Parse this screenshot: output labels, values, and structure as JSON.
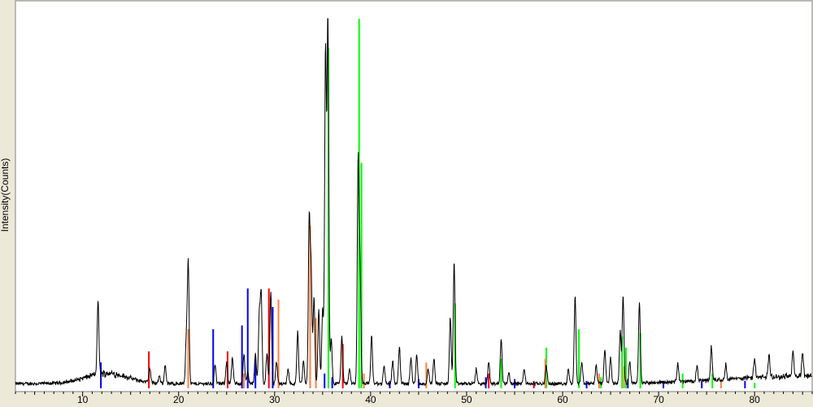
{
  "chart_data": {
    "type": "line",
    "title": "",
    "xlabel": "",
    "ylabel": "Intensity(Counts)",
    "xlim": [
      3,
      86
    ],
    "ylim": [
      0,
      1000
    ],
    "xticks": [
      10,
      20,
      30,
      40,
      50,
      60,
      70,
      80
    ],
    "grid": false,
    "colors": {
      "background": "#ffffff",
      "frame": "#ece9d8",
      "pattern": "#000000",
      "blue": "#0000ff",
      "red": "#ff0000",
      "orange": "#ff8040",
      "green": "#00ff00"
    },
    "pattern": {
      "name": "",
      "color": "#000000",
      "baseline": 8,
      "noise": 9,
      "humps": [
        {
          "center": 12.5,
          "width": 2.2,
          "height": 35
        },
        {
          "center": 85,
          "width": 8,
          "height": 25
        }
      ],
      "peaks": [
        [
          11.6,
          200
        ],
        [
          17.0,
          40
        ],
        [
          18.0,
          20
        ],
        [
          18.6,
          50
        ],
        [
          20.8,
          120
        ],
        [
          21.0,
          330
        ],
        [
          23.8,
          50
        ],
        [
          25.0,
          60
        ],
        [
          25.6,
          70
        ],
        [
          26.8,
          80
        ],
        [
          27.2,
          30
        ],
        [
          28.0,
          80
        ],
        [
          28.4,
          180
        ],
        [
          28.6,
          240
        ],
        [
          29.2,
          80
        ],
        [
          29.6,
          250
        ],
        [
          30.2,
          60
        ],
        [
          31.4,
          40
        ],
        [
          32.4,
          140
        ],
        [
          33.0,
          60
        ],
        [
          33.6,
          440
        ],
        [
          33.8,
          300
        ],
        [
          34.1,
          240
        ],
        [
          34.6,
          200
        ],
        [
          35.0,
          200
        ],
        [
          35.3,
          900
        ],
        [
          35.55,
          1000
        ],
        [
          35.9,
          120
        ],
        [
          37.0,
          130
        ],
        [
          37.8,
          40
        ],
        [
          38.7,
          600
        ],
        [
          38.9,
          300
        ],
        [
          40.1,
          130
        ],
        [
          41.4,
          50
        ],
        [
          42.3,
          60
        ],
        [
          43.0,
          100
        ],
        [
          44.2,
          70
        ],
        [
          44.8,
          80
        ],
        [
          46.0,
          40
        ],
        [
          46.6,
          70
        ],
        [
          48.3,
          180
        ],
        [
          48.7,
          330
        ],
        [
          51.0,
          40
        ],
        [
          52.3,
          60
        ],
        [
          53.6,
          120
        ],
        [
          54.4,
          30
        ],
        [
          56.0,
          40
        ],
        [
          58.3,
          50
        ],
        [
          60.6,
          40
        ],
        [
          61.3,
          240
        ],
        [
          62.0,
          60
        ],
        [
          63.5,
          50
        ],
        [
          64.4,
          90
        ],
        [
          65.0,
          70
        ],
        [
          66.0,
          140
        ],
        [
          66.3,
          240
        ],
        [
          67.0,
          60
        ],
        [
          68.0,
          220
        ],
        [
          72.0,
          50
        ],
        [
          74.0,
          40
        ],
        [
          75.5,
          90
        ],
        [
          77.0,
          40
        ],
        [
          80.0,
          50
        ],
        [
          81.5,
          60
        ],
        [
          84.0,
          70
        ],
        [
          85.0,
          60
        ]
      ]
    },
    "reference_sticks": [
      {
        "color": "#00ff00",
        "sticks": [
          [
            35.6,
            920
          ],
          [
            38.8,
            1000
          ],
          [
            39.05,
            610
          ],
          [
            48.8,
            230
          ],
          [
            53.6,
            80
          ],
          [
            58.3,
            110
          ],
          [
            61.7,
            160
          ],
          [
            66.2,
            140
          ],
          [
            66.6,
            110
          ],
          [
            68.1,
            150
          ],
          [
            72.5,
            40
          ],
          [
            75.6,
            40
          ],
          [
            64.0,
            30
          ],
          [
            80.0,
            15
          ]
        ]
      },
      {
        "color": "#0000ff",
        "sticks": [
          [
            11.9,
            70
          ],
          [
            23.6,
            160
          ],
          [
            26.6,
            170
          ],
          [
            27.2,
            270
          ],
          [
            28.0,
            80
          ],
          [
            29.8,
            220
          ],
          [
            35.2,
            40
          ],
          [
            36.0,
            30
          ],
          [
            42.0,
            20
          ],
          [
            45.0,
            25
          ],
          [
            52.0,
            30
          ],
          [
            55.0,
            25
          ],
          [
            62.5,
            20
          ],
          [
            66.8,
            25
          ],
          [
            70.5,
            20
          ],
          [
            74.5,
            20
          ],
          [
            79.0,
            20
          ]
        ]
      },
      {
        "color": "#ff0000",
        "sticks": [
          [
            16.9,
            100
          ],
          [
            25.1,
            100
          ],
          [
            29.4,
            270
          ],
          [
            33.7,
            80
          ],
          [
            37.1,
            120
          ],
          [
            52.3,
            40
          ],
          [
            57.0,
            20
          ]
        ]
      },
      {
        "color": "#ff8040",
        "sticks": [
          [
            21.0,
            160
          ],
          [
            26.8,
            40
          ],
          [
            30.4,
            240
          ],
          [
            33.7,
            440
          ],
          [
            34.3,
            190
          ],
          [
            39.3,
            40
          ],
          [
            45.8,
            70
          ],
          [
            58.2,
            80
          ],
          [
            63.8,
            40
          ],
          [
            66.4,
            60
          ],
          [
            76.5,
            20
          ]
        ]
      }
    ]
  }
}
